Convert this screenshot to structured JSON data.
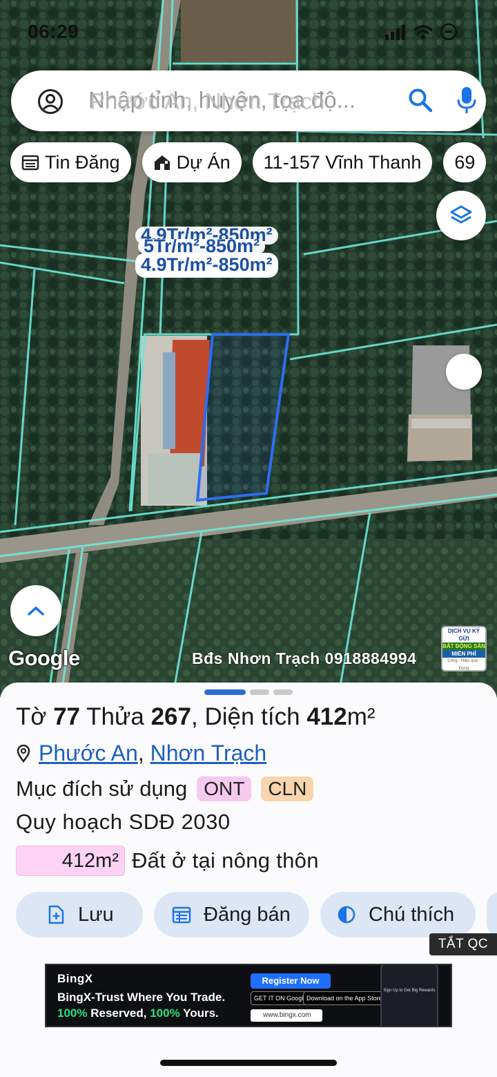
{
  "status_bar": {
    "time": "06:29"
  },
  "search": {
    "placeholder": "Nhập tỉnh, huyện, tọa độ...",
    "ghost_text": "Phước An, Nhơn Trạch"
  },
  "chips": [
    {
      "icon": "calendar-list-icon",
      "label": "Tin Đăng"
    },
    {
      "icon": "house-icon",
      "label": "Dự Án"
    },
    {
      "icon": "",
      "label": "11-157 Vĩnh Thanh"
    },
    {
      "icon": "",
      "label": "69"
    }
  ],
  "map": {
    "price_tags": [
      "4.9Tr/m²-850m²",
      "5Tr/m²-850m²",
      "4.9Tr/m²-850m²"
    ],
    "google_label": "Google",
    "watermark": "Bđs Nhơn Trạch 0918884994",
    "mini_ad": {
      "line1": "DỊCH VỤ KÝ GỬI",
      "line2": "BẤT ĐỘNG SẢN",
      "line3": "MIỄN PHÍ",
      "line4": "Công - Hiệu quả - Đúng"
    }
  },
  "parcel": {
    "prefix_sheet": "Tờ",
    "sheet": "77",
    "prefix_lot": "Thửa",
    "lot": "267",
    "prefix_area": ", Diện tích",
    "area": "412",
    "area_unit": "m²",
    "ward": "Phước An",
    "district": "Nhơn Trạch",
    "purpose_label": "Mục đích sử dụng",
    "purpose_codes": [
      "ONT",
      "CLN"
    ],
    "plan_label": "Quy hoạch SDĐ 2030",
    "plan_area": "412m²",
    "plan_area_label": "Đất ở tại nông thôn"
  },
  "actions": [
    {
      "icon": "file-add-icon",
      "label": "Lưu"
    },
    {
      "icon": "calendar-list-icon",
      "label": "Đăng bán"
    },
    {
      "icon": "contrast-icon",
      "label": "Chú thích"
    }
  ],
  "ad": {
    "close_label": "TẮT QC",
    "brand": "BingX",
    "line1": "BingX-Trust Where You Trade.",
    "line2_a": "100%",
    "line2_b": " Reserved, ",
    "line2_c": "100%",
    "line2_d": " Yours.",
    "cta": "Register Now",
    "store1": "GET IT ON Google Play",
    "store2": "Download on the App Store",
    "url": "www.bingx.com",
    "phone_text": "Sign Up to Get Big Rewards"
  },
  "colors": {
    "accent": "#1e5fbf",
    "parcel_outline": "#2d6df0",
    "cadastral_line": "#6ee8d8",
    "ont_badge": "#f6c9ef",
    "cln_badge": "#f8d5ad"
  }
}
